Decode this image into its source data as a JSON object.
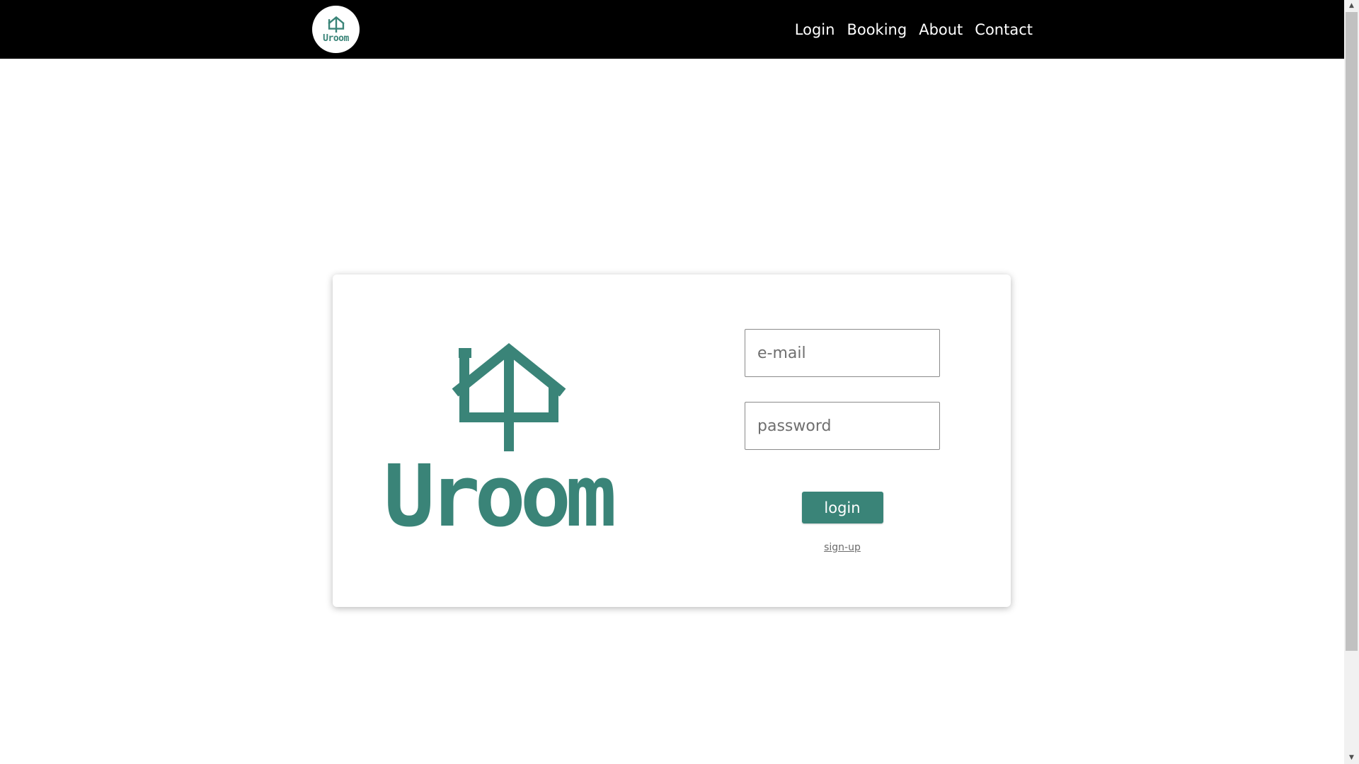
{
  "theme": {
    "brand_color": "#3a8478",
    "nav_background": "#000000",
    "page_background": "#ffffff"
  },
  "navbar": {
    "logo_text": "Uroom",
    "logo_icon": "house-icon",
    "links": [
      {
        "label": "Login"
      },
      {
        "label": "Booking"
      },
      {
        "label": "About"
      },
      {
        "label": "Contact"
      }
    ]
  },
  "login_card": {
    "brand_icon": "house-icon",
    "brand_name": "Uroom",
    "email": {
      "value": "",
      "placeholder": "e-mail"
    },
    "password": {
      "value": "",
      "placeholder": "password"
    },
    "login_button_label": "login",
    "signup_link_label": "sign-up"
  },
  "scrollbar": {
    "up_icon": "arrow-up-icon",
    "down_icon": "arrow-down-icon"
  }
}
